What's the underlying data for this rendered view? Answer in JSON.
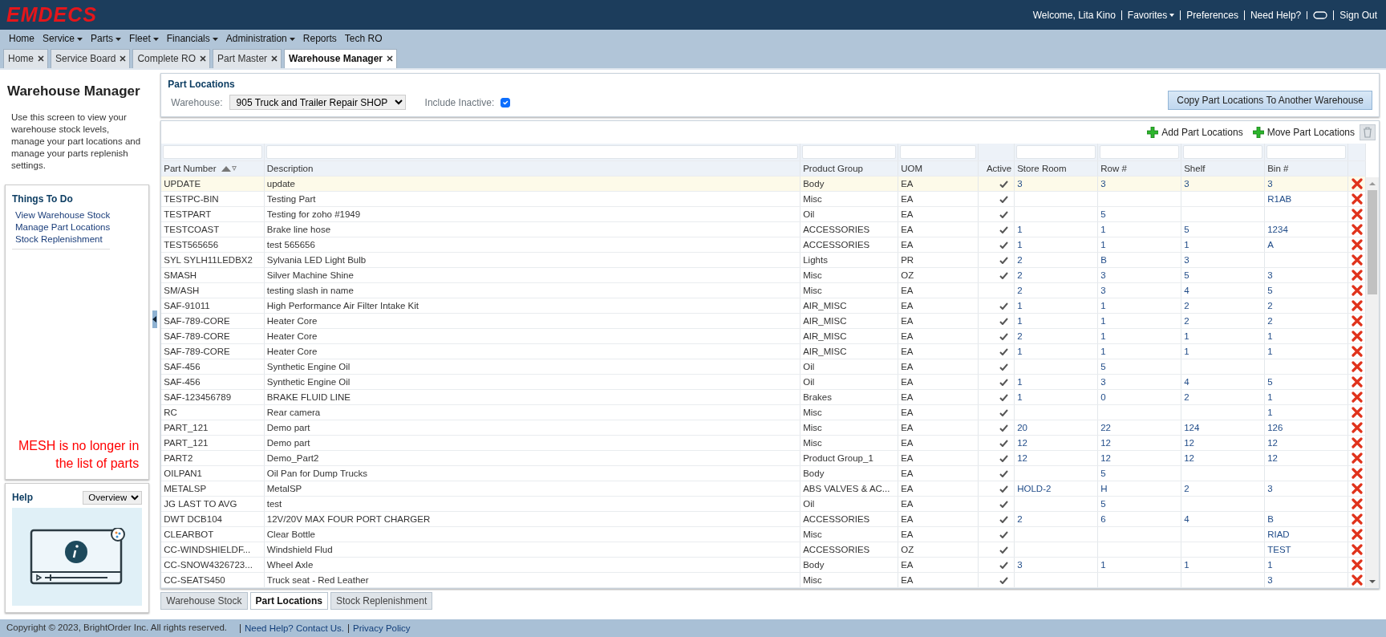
{
  "header": {
    "logo": "EMDECS",
    "links": [
      {
        "label": "Welcome, Lita Kino",
        "kind": "text"
      },
      {
        "label": "Favorites",
        "kind": "menu"
      },
      {
        "label": "Preferences",
        "kind": "link"
      },
      {
        "label": "Need Help?",
        "kind": "link"
      },
      {
        "kind": "chat"
      },
      {
        "label": "Sign Out",
        "kind": "link"
      }
    ]
  },
  "menu": [
    {
      "label": "Home",
      "dropdown": false
    },
    {
      "label": "Service",
      "dropdown": true
    },
    {
      "label": "Parts",
      "dropdown": true
    },
    {
      "label": "Fleet",
      "dropdown": true
    },
    {
      "label": "Financials",
      "dropdown": true
    },
    {
      "label": "Administration",
      "dropdown": true
    },
    {
      "label": "Reports",
      "dropdown": false
    },
    {
      "label": "Tech RO",
      "dropdown": false
    }
  ],
  "tabs": [
    {
      "label": "Home",
      "selected": false
    },
    {
      "label": "Service Board",
      "selected": false
    },
    {
      "label": "Complete RO",
      "selected": false
    },
    {
      "label": "Part Master",
      "selected": false
    },
    {
      "label": "Warehouse Manager",
      "selected": true
    }
  ],
  "sidebar": {
    "title": "Warehouse Manager",
    "description": "Use this screen to view your warehouse stock levels, manage your part locations and manage your parts replenish settings.",
    "todo": {
      "title": "Things To Do",
      "items": [
        "View Warehouse Stock",
        "Manage Part Locations",
        "Stock Replenishment"
      ]
    },
    "annotation": "MESH is no longer in the list of parts",
    "help": {
      "title": "Help",
      "select": "Overview"
    }
  },
  "filters": {
    "title": "Part Locations",
    "warehouse_label": "Warehouse:",
    "warehouse": "905 Truck and Trailer Repair SHOP",
    "inactive_label": "Include Inactive:",
    "include_inactive": true,
    "copy_button": "Copy Part Locations To Another Warehouse"
  },
  "toolbar": [
    "Add Part Locations",
    "Move Part Locations"
  ],
  "table": {
    "columns": [
      {
        "label": "Part Number",
        "filter": true,
        "sortable": true
      },
      {
        "label": "Description",
        "filter": true,
        "sortable": false
      },
      {
        "label": "Product Group",
        "filter": true,
        "sortable": false
      },
      {
        "label": "UOM",
        "filter": true,
        "sortable": false
      },
      {
        "label": "Active",
        "filter": false,
        "sortable": false
      },
      {
        "label": "Store Room",
        "filter": true,
        "sortable": false
      },
      {
        "label": "Row #",
        "filter": true,
        "sortable": false
      },
      {
        "label": "Shelf",
        "filter": true,
        "sortable": false
      },
      {
        "label": "Bin #",
        "filter": true,
        "sortable": false
      }
    ],
    "rows": [
      {
        "cells": [
          "UPDATE",
          "update",
          "Body",
          "EA",
          null,
          "3",
          "3",
          "3",
          "3"
        ],
        "active": true,
        "selected": true
      },
      {
        "cells": [
          "TESTPC-BIN",
          "Testing Part",
          "Misc",
          "EA",
          null,
          null,
          null,
          null,
          "R1AB"
        ],
        "active": true,
        "selected": false
      },
      {
        "cells": [
          "TESTPART",
          "Testing for zoho #1949",
          "Oil",
          "EA",
          null,
          null,
          "5",
          null,
          null
        ],
        "active": true,
        "selected": false
      },
      {
        "cells": [
          "TESTCOAST",
          "Brake line hose",
          "ACCESSORIES",
          "EA",
          null,
          "1",
          "1",
          "5",
          "1234"
        ],
        "active": true,
        "selected": false
      },
      {
        "cells": [
          "TEST565656",
          "test 565656",
          "ACCESSORIES",
          "EA",
          null,
          "1",
          "1",
          "1",
          "A"
        ],
        "active": true,
        "selected": false
      },
      {
        "cells": [
          "SYL SYLH11LEDBX2",
          "Sylvania LED Light Bulb",
          "Lights",
          "PR",
          null,
          "2",
          "B",
          "3",
          null
        ],
        "active": true,
        "selected": false
      },
      {
        "cells": [
          "SMASH",
          "Silver Machine Shine",
          "Misc",
          "OZ",
          null,
          "2",
          "3",
          "5",
          "3"
        ],
        "active": true,
        "selected": false
      },
      {
        "cells": [
          "SM/ASH",
          "testing slash in name",
          "Misc",
          "EA",
          null,
          "2",
          "3",
          "4",
          "5"
        ],
        "active": false,
        "selected": false
      },
      {
        "cells": [
          "SAF-91011",
          "High Performance Air Filter Intake Kit",
          "AIR_MISC",
          "EA",
          null,
          "1",
          "1",
          "2",
          "2"
        ],
        "active": true,
        "selected": false
      },
      {
        "cells": [
          "SAF-789-CORE",
          "Heater Core",
          "AIR_MISC",
          "EA",
          null,
          "1",
          "1",
          "2",
          "2"
        ],
        "active": true,
        "selected": false
      },
      {
        "cells": [
          "SAF-789-CORE",
          "Heater Core",
          "AIR_MISC",
          "EA",
          null,
          "2",
          "1",
          "1",
          "1"
        ],
        "active": true,
        "selected": false
      },
      {
        "cells": [
          "SAF-789-CORE",
          "Heater Core",
          "AIR_MISC",
          "EA",
          null,
          "1",
          "1",
          "1",
          "1"
        ],
        "active": true,
        "selected": false
      },
      {
        "cells": [
          "SAF-456",
          "Synthetic Engine Oil",
          "Oil",
          "EA",
          null,
          null,
          "5",
          null,
          null
        ],
        "active": true,
        "selected": false
      },
      {
        "cells": [
          "SAF-456",
          "Synthetic Engine Oil",
          "Oil",
          "EA",
          null,
          "1",
          "3",
          "4",
          "5"
        ],
        "active": true,
        "selected": false
      },
      {
        "cells": [
          "SAF-123456789",
          "BRAKE FLUID LINE",
          "Brakes",
          "EA",
          null,
          "1",
          "0",
          "2",
          "1"
        ],
        "active": true,
        "selected": false
      },
      {
        "cells": [
          "RC",
          "Rear camera",
          "Misc",
          "EA",
          null,
          null,
          null,
          null,
          "1"
        ],
        "active": true,
        "selected": false
      },
      {
        "cells": [
          "PART_121",
          "Demo part",
          "Misc",
          "EA",
          null,
          "20",
          "22",
          "124",
          "126"
        ],
        "active": true,
        "selected": false
      },
      {
        "cells": [
          "PART_121",
          "Demo part",
          "Misc",
          "EA",
          null,
          "12",
          "12",
          "12",
          "12"
        ],
        "active": true,
        "selected": false
      },
      {
        "cells": [
          "PART2",
          "Demo_Part2",
          "Product Group_1",
          "EA",
          null,
          "12",
          "12",
          "12",
          "12"
        ],
        "active": true,
        "selected": false
      },
      {
        "cells": [
          "OILPAN1",
          "Oil Pan for Dump Trucks",
          "Body",
          "EA",
          null,
          null,
          "5",
          null,
          null
        ],
        "active": true,
        "selected": false
      },
      {
        "cells": [
          "METALSP",
          "MetalSP",
          "ABS VALVES & AC...",
          "EA",
          null,
          "HOLD-2",
          "H",
          "2",
          "3"
        ],
        "active": true,
        "selected": false
      },
      {
        "cells": [
          "JG LAST TO AVG",
          "test",
          "Oil",
          "EA",
          null,
          null,
          "5",
          null,
          null
        ],
        "active": true,
        "selected": false
      },
      {
        "cells": [
          "DWT DCB104",
          "12V/20V MAX FOUR PORT CHARGER",
          "ACCESSORIES",
          "EA",
          null,
          "2",
          "6",
          "4",
          "B"
        ],
        "active": true,
        "selected": false
      },
      {
        "cells": [
          "CLEARBOT",
          "Clear Bottle",
          "Misc",
          "EA",
          null,
          null,
          null,
          null,
          "RIAD"
        ],
        "active": true,
        "selected": false
      },
      {
        "cells": [
          "CC-WINDSHIELDF...",
          "Windshield Flud",
          "ACCESSORIES",
          "OZ",
          null,
          null,
          null,
          null,
          "TEST"
        ],
        "active": true,
        "selected": false
      },
      {
        "cells": [
          "CC-SNOW4326723...",
          "Wheel Axle",
          "Body",
          "EA",
          null,
          "3",
          "1",
          "1",
          "1"
        ],
        "active": true,
        "selected": false
      },
      {
        "cells": [
          "CC-SEATS450",
          "Truck seat - Red Leather",
          "Misc",
          "EA",
          null,
          null,
          null,
          null,
          "3"
        ],
        "active": true,
        "selected": false
      }
    ]
  },
  "bottom_tabs": [
    {
      "label": "Warehouse Stock",
      "selected": false
    },
    {
      "label": "Part Locations",
      "selected": true
    },
    {
      "label": "Stock Replenishment",
      "selected": false
    }
  ],
  "footer": {
    "copyright": "Copyright © 2023, BrightOrder Inc. All rights reserved.",
    "links": [
      "Need Help? Contact Us.",
      "Privacy Policy"
    ]
  }
}
